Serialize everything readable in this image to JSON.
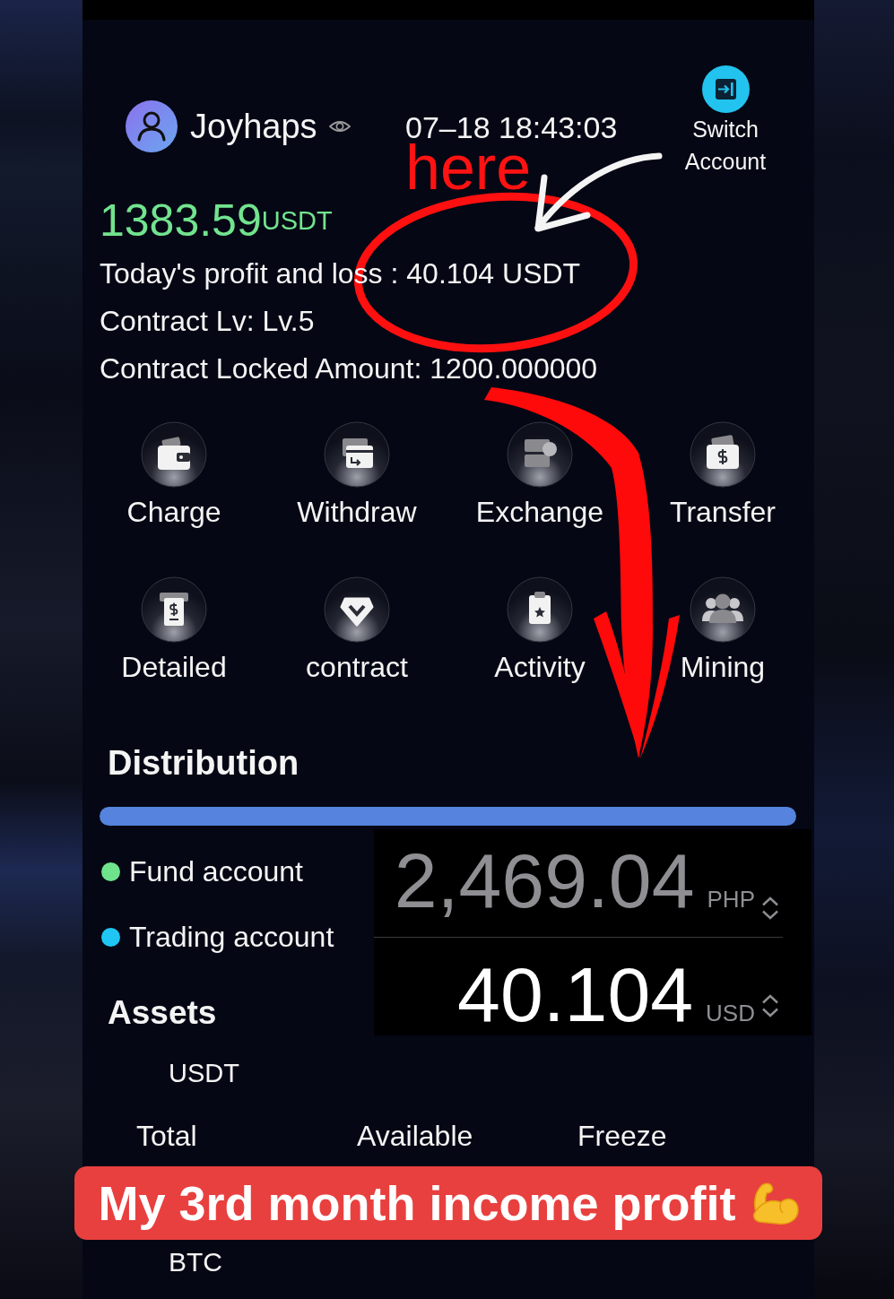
{
  "header": {
    "username": "Joyhaps",
    "datetime": "07–18 18:43:03",
    "switch_account": "Switch Account"
  },
  "annotation": {
    "note": "here"
  },
  "balance": {
    "amount": "1383.59",
    "unit": "USDT"
  },
  "info_lines": [
    "Today's profit and loss : 40.104 USDT",
    "Contract Lv: Lv.5",
    "Contract Locked Amount: 1200.000000"
  ],
  "shortcuts": [
    {
      "kind": "wallet",
      "label": "Charge"
    },
    {
      "kind": "card",
      "label": "Withdraw"
    },
    {
      "kind": "cards",
      "label": "Exchange"
    },
    {
      "kind": "money",
      "label": "Transfer"
    },
    {
      "kind": "receipt",
      "label": "Detailed"
    },
    {
      "kind": "gem",
      "label": "contract"
    },
    {
      "kind": "clipboard",
      "label": "Activity"
    },
    {
      "kind": "people",
      "label": "Mining"
    }
  ],
  "distribution": {
    "title": "Distribution",
    "legend": [
      {
        "label": "Fund account",
        "color": "#6fe28c"
      },
      {
        "label": "Trading account",
        "color": "#1fc6f4"
      }
    ]
  },
  "converter": {
    "rows": [
      {
        "amount": "2,469.04",
        "currency": "PHP",
        "selected": false
      },
      {
        "amount": "40.104",
        "currency": "USD",
        "selected": true
      }
    ]
  },
  "assets": {
    "title": "Assets",
    "items": [
      {
        "name": "USDT",
        "columns": [
          "Total",
          "Available",
          "Freeze"
        ]
      },
      {
        "name": "BTC"
      }
    ]
  },
  "caption": {
    "text": "My 3rd month income profit"
  }
}
